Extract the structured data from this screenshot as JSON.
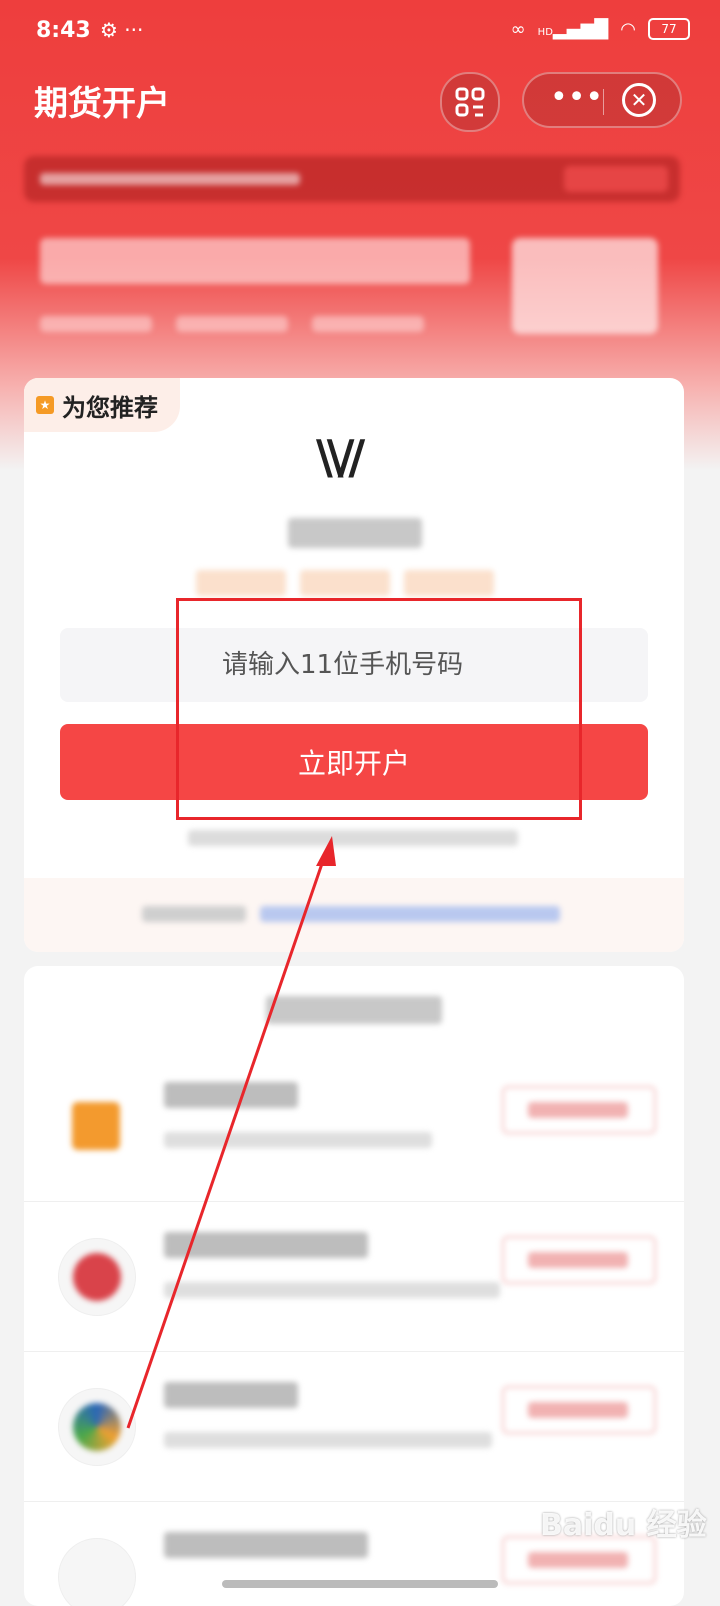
{
  "status_bar": {
    "time": "8:43",
    "left_icons": "⚙ ···",
    "network": "HD",
    "battery": "77"
  },
  "header": {
    "title": "期货开户",
    "qr_icon": "qr-scan-icon",
    "more_icon": "more-dots-icon",
    "close_icon": "close-circle-icon"
  },
  "recommend": {
    "label": "为您推荐"
  },
  "form": {
    "phone_placeholder": "请输入11位手机号码",
    "submit_label": "立即开户"
  },
  "colors": {
    "brand_red": "#ef4746",
    "button_red": "#f54645",
    "highlight": "#e8262b"
  }
}
